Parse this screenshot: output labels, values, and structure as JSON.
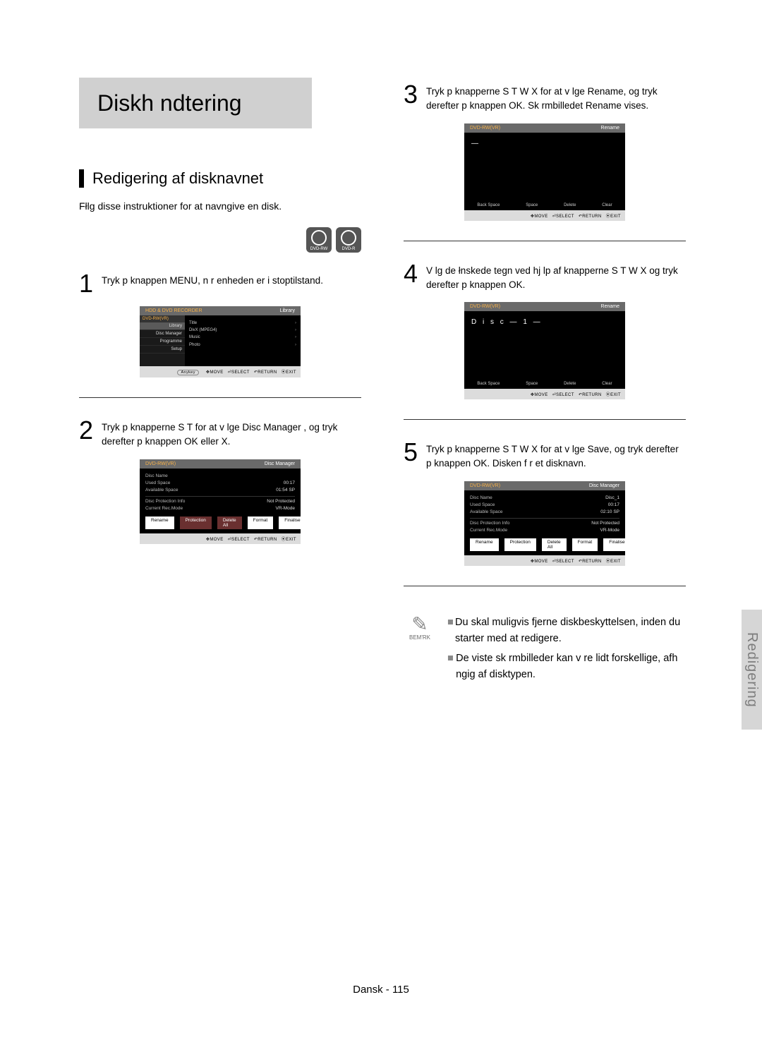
{
  "page_title": "Diskh ndtering",
  "section_title": "Redigering af disknavnet",
  "intro": "Fłlg disse instruktioner for at navngive en disk.",
  "disc_icons": [
    "DVD-RW",
    "DVD-R"
  ],
  "side_tab": "Redigering",
  "page_number": "Dansk - 115",
  "steps": {
    "s1": {
      "num": "1",
      "text": "Tryk p  knappen  MENU, n r enheden er i stoptilstand."
    },
    "s2": {
      "num": "2",
      "text": "Tryk p  knapperne  S T  for at v lge   Disc Manager , og tryk derefter p  knappen  OK  eller  X."
    },
    "s3": {
      "num": "3",
      "text": "Tryk p  knapperne  S T W X for at v lge   Rename, og tryk derefter p  knappen  OK. Sk rmbilledet Rename vises."
    },
    "s4": {
      "num": "4",
      "text": "V lg de łnskede tegn ved hj lp af knapperne S T W X og tryk derefter p  knappen  OK."
    },
    "s5": {
      "num": "5",
      "text": "Tryk p  knapperne  S T W X for at v lge   Save, og tryk derefter p  knappen  OK. Disken f r et disknavn."
    }
  },
  "note_label": "BEM'RK",
  "notes": [
    "Du skal muligvis fjerne diskbeskyttelsen, inden du starter med at redigere.",
    "De viste sk rmbilleder kan v re lidt forskellige, afh ngig af disktypen."
  ],
  "osd_footer": {
    "move": "MOVE",
    "select": "SELECT",
    "return": "RETURN",
    "exit": "EXIT",
    "anykey": "Anykey"
  },
  "osd1": {
    "header_left": "HDD & DVD RECORDER",
    "header_right": "Library",
    "sub": "DVD-RW(VR)",
    "side": [
      "Library",
      "Disc Manager",
      "Programme",
      "Setup"
    ],
    "rows": [
      {
        "l": "Title",
        "r": "›"
      },
      {
        "l": "DivX (MPEG4)",
        "r": "›"
      },
      {
        "l": "Music",
        "r": "›"
      },
      {
        "l": "Photo",
        "r": "›"
      }
    ]
  },
  "osd2": {
    "header_left": "DVD-RW(VR)",
    "header_right": "Disc Manager",
    "rows1": [
      {
        "l": "Disc Name",
        "r": ""
      },
      {
        "l": "Used Space",
        "r": "00:17"
      },
      {
        "l": "Available Space",
        "r": "01:54 SP"
      }
    ],
    "rows2": [
      {
        "l": "Disc Protection Info",
        "r": "Not Protected"
      },
      {
        "l": "Current Rec.Mode",
        "r": "VR-Mode"
      }
    ],
    "tabs": [
      "Rename",
      "Protection",
      "Delete All",
      "Format",
      "Finalise"
    ]
  },
  "osd3": {
    "header_left": "DVD-RW(VR)",
    "header_right": "Rename",
    "cursor": "—",
    "labels": [
      "Back Space",
      "Space",
      "Delete",
      "Clear"
    ]
  },
  "osd4": {
    "header_left": "DVD-RW(VR)",
    "header_right": "Rename",
    "cursor": "D i s c — 1 —",
    "labels": [
      "Back Space",
      "Space",
      "Delete",
      "Clear"
    ]
  },
  "osd5": {
    "header_left": "DVD-RW(VR)",
    "header_right": "Disc Manager",
    "rows1": [
      {
        "l": "Disc Name",
        "r": "Disc_1"
      },
      {
        "l": "Used Space",
        "r": "00:17"
      },
      {
        "l": "Available Space",
        "r": "02:10 SP"
      }
    ],
    "rows2": [
      {
        "l": "Disc Protection Info",
        "r": "Not Protected"
      },
      {
        "l": "Current Rec.Mode",
        "r": "VR-Mode"
      }
    ],
    "tabs": [
      "Rename",
      "Protection",
      "Delete All",
      "Format",
      "Finalise"
    ]
  }
}
